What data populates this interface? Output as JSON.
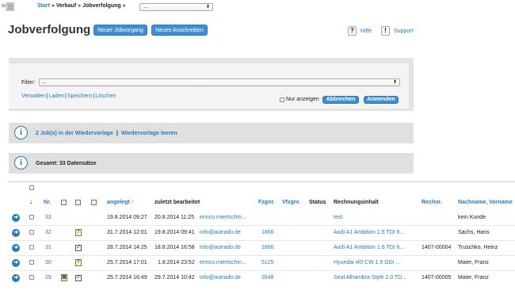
{
  "topbar": {
    "crumb_start": "Start",
    "crumb_sales": "Verkauf",
    "crumb_current": "Jobverfolgung",
    "select_value": "..."
  },
  "header": {
    "title": "Jobverfolgung",
    "new_job_button": "Neuer Jobvorgang",
    "new_letter_button": "Neues Anschreiben",
    "help_label": "Hilfe",
    "support_label": "Support"
  },
  "filter": {
    "label": "Filter:",
    "select_value": "...",
    "links": [
      "Verwalten",
      "Laden",
      "Speichern",
      "Löschen"
    ],
    "only_show_label": "Nur anzeigen",
    "show_button": "Abbrechen",
    "apply_button": "Anwenden"
  },
  "info": {
    "resubmission_text": "2 Job(s) in der Wiedervorlage",
    "clear_link": "Wiedervorlage leeren",
    "total_text": "Gesamt: 33 Datensätze"
  },
  "table": {
    "headers": {
      "nr": "Nr.",
      "created": "angelegt ↑",
      "edited": "zuletzt bearbeitet",
      "vehicle_nr": "Fzgnr.",
      "contract_nr": "Vfzgnr.",
      "status": "Status",
      "invoice_content": "Rechnungsinhalt",
      "invoice_nr": "Rechnr.",
      "name": "Nachname, Vorname"
    },
    "rows": [
      {
        "nr": "33",
        "created": "19.8.2014 09:27",
        "edited": "20.8.2014 11:25",
        "user": "enrico.miertschin...",
        "vehicle": "",
        "content": "test",
        "invoice": "",
        "name": "kein Kunde",
        "icon": "none"
      },
      {
        "nr": "32",
        "created": "31.7.2014 12:01",
        "edited": "19.8.2014 09:41",
        "user": "info@autrado.de",
        "vehicle": "1866",
        "content": "Audi A1 Ambition 1.6 TDI 6...",
        "invoice": "",
        "name": "Sachs, Hans",
        "icon": "question"
      },
      {
        "nr": "31",
        "created": "28.7.2014 14:25",
        "edited": "18.8.2014 16:58",
        "user": "info@autrado.de",
        "vehicle": "1866",
        "content": "Audi A1 Ambition 1.6 TDI 6...",
        "invoice": "1407-00004",
        "name": "Truschko, Heinz",
        "icon": "check"
      },
      {
        "nr": "30",
        "created": "25.7.2014 17:01",
        "edited": "1.8.2014 23:52",
        "user": "enrico.miertschin...",
        "vehicle": "5125",
        "content": "Hyundai i40 CW 1.6 GDi ...",
        "invoice": "",
        "name": "Maier, Franz",
        "icon": "question"
      },
      {
        "nr": "29",
        "created": "25.7.2014 16:49",
        "edited": "29.7.2014 10:42",
        "user": "info@autrado.de",
        "vehicle": "2648",
        "content": "Seat Alhambra Style 2.0 TD...",
        "invoice": "1407-00005",
        "name": "Maier, Franz",
        "icon": "check"
      }
    ]
  },
  "colors": {
    "accent": "#2a7ab8",
    "button": "#3f8fd0",
    "panel": "#e3e3e3"
  }
}
